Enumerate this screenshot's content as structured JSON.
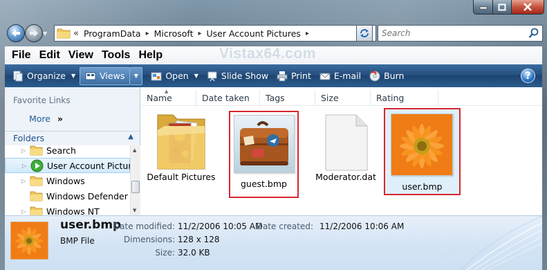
{
  "watermark": "Vistax64.com",
  "address": {
    "prefix": "«",
    "crumbs": [
      "ProgramData",
      "Microsoft",
      "User Account Pictures"
    ],
    "separator": "▸"
  },
  "search": {
    "placeholder": "Search"
  },
  "menu": [
    "File",
    "Edit",
    "View",
    "Tools",
    "Help"
  ],
  "commands": {
    "organize": "Organize",
    "views": "Views",
    "open": "Open",
    "slideshow": "Slide Show",
    "print": "Print",
    "email": "E-mail",
    "burn": "Burn"
  },
  "nav": {
    "favorite_links": "Favorite Links",
    "more": "More",
    "more_chevron": "»",
    "folders": "Folders",
    "tree": [
      "Search",
      "User Account Pictures",
      "Windows",
      "Windows Defender",
      "Windows NT"
    ]
  },
  "columns": [
    "Name",
    "Date taken",
    "Tags",
    "Size",
    "Rating"
  ],
  "files": [
    {
      "name": "Default Pictures",
      "kind": "folder"
    },
    {
      "name": "guest.bmp",
      "kind": "image-suitcase"
    },
    {
      "name": "Moderator.dat",
      "kind": "document"
    },
    {
      "name": "user.bmp",
      "kind": "image-flower"
    }
  ],
  "details": {
    "name": "user.bmp",
    "type": "BMP File",
    "date_modified_label": "Date modified:",
    "date_modified": "11/2/2006 10:05 AM",
    "date_created_label": "Date created:",
    "date_created": "11/2/2006 10:06 AM",
    "dimensions_label": "Dimensions:",
    "dimensions": "128 x 128",
    "size_label": "Size:",
    "size": "32.0 KB"
  },
  "colors": {
    "accent": "#d9262f",
    "command_bar": "#264f7f",
    "link": "#1e5f9c"
  }
}
